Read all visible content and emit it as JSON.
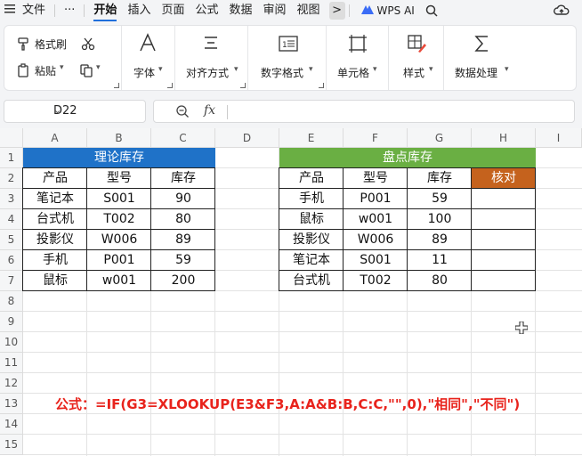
{
  "menu": {
    "items": [
      "文件",
      "开始",
      "插入",
      "页面",
      "公式",
      "数据",
      "审阅",
      "视图"
    ],
    "more": "···",
    "chevron": ">",
    "wps_ai": "WPS AI",
    "active": "开始"
  },
  "ribbon": {
    "format_painter": "格式刷",
    "paste": "粘贴",
    "font": "字体",
    "align": "对齐方式",
    "number_format": "数字格式",
    "cell": "单元格",
    "style": "样式",
    "data_process": "数据处理"
  },
  "formula_bar": {
    "name_box": "D22",
    "fx": "fx",
    "value": ""
  },
  "columns": [
    "A",
    "B",
    "C",
    "D",
    "E",
    "F",
    "G",
    "H",
    "I"
  ],
  "rows": [
    "1",
    "2",
    "3",
    "4",
    "5",
    "6",
    "7",
    "8",
    "9",
    "10",
    "11",
    "12",
    "13",
    "14",
    "15"
  ],
  "table_left": {
    "title": "理论库存",
    "headers": [
      "产品",
      "型号",
      "库存"
    ],
    "rows": [
      [
        "笔记本",
        "S001",
        "90"
      ],
      [
        "台式机",
        "T002",
        "80"
      ],
      [
        "投影仪",
        "W006",
        "89"
      ],
      [
        "手机",
        "P001",
        "59"
      ],
      [
        "鼠标",
        "w001",
        "200"
      ]
    ]
  },
  "table_right": {
    "title": "盘点库存",
    "headers": [
      "产品",
      "型号",
      "库存",
      "核对"
    ],
    "rows": [
      [
        "手机",
        "P001",
        "59",
        ""
      ],
      [
        "鼠标",
        "w001",
        "100",
        ""
      ],
      [
        "投影仪",
        "W006",
        "89",
        ""
      ],
      [
        "笔记本",
        "S001",
        "11",
        ""
      ],
      [
        "台式机",
        "T002",
        "80",
        ""
      ]
    ]
  },
  "note": "公式：=IF(G3=XLOOKUP(E3&F3,A:A&B:B,C:C,\"\",0),\"相同\",\"不同\")",
  "colors": {
    "blue_header": "#1f72c8",
    "green_header": "#6aaf43",
    "orange_header": "#c5621d",
    "formula_red": "#e8231c"
  }
}
